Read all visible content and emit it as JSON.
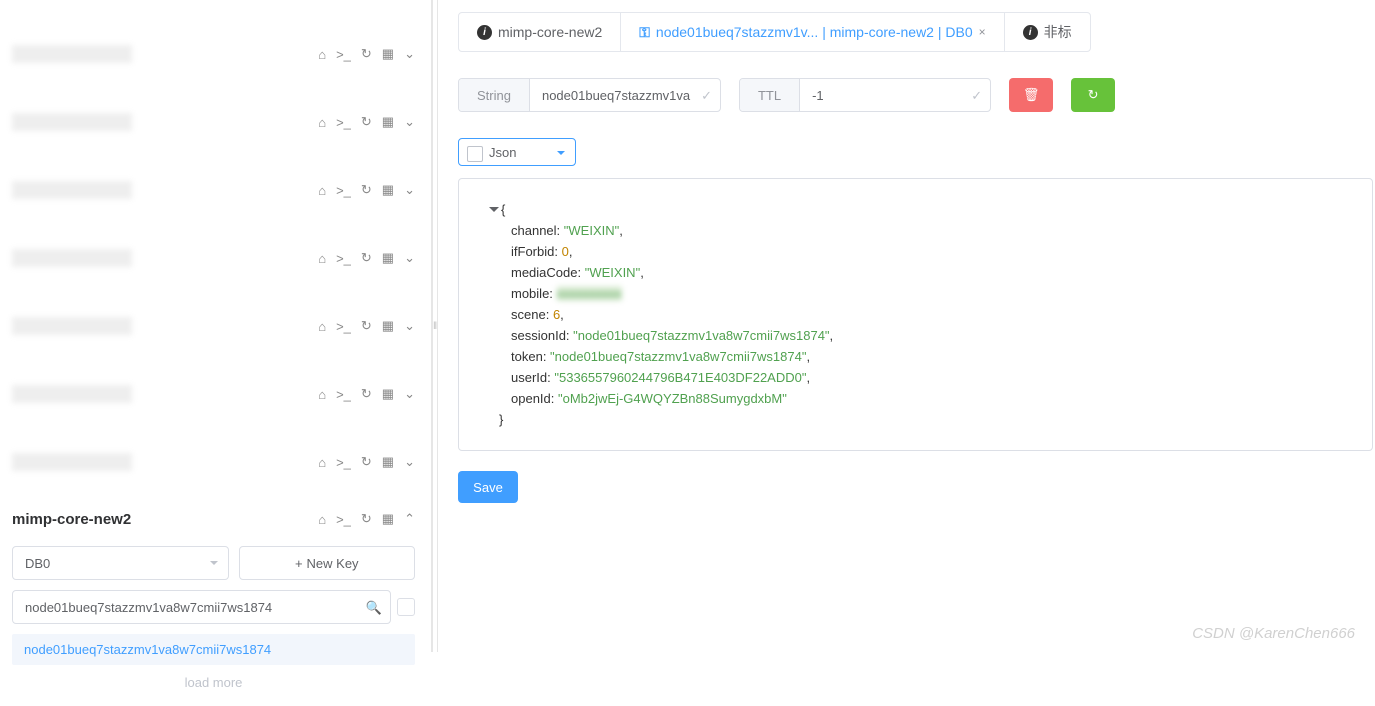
{
  "sidebar": {
    "connections": [
      0,
      1,
      2,
      3,
      4,
      5,
      6
    ],
    "openConn": {
      "title": "mimp-core-new2",
      "db": "DB0",
      "newKey": "New Key",
      "searchVal": "node01bueq7stazzmv1va8w7cmii7ws1874",
      "keyItem": "node01bueq7stazzmv1va8w7cmii7ws1874",
      "loadMore": "load more"
    }
  },
  "tabs": {
    "t1": "mimp-core-new2",
    "t2": "node01bueq7stazzmv1v... | mimp-core-new2 | DB0",
    "t3": "非标"
  },
  "fields": {
    "typeLabel": "String",
    "typeVal": "node01bueq7stazzmv1va",
    "ttlLabel": "TTL",
    "ttlVal": "-1"
  },
  "format": "Json",
  "json": {
    "channel": "\"WEIXIN\"",
    "ifForbid": "0",
    "mediaCode": "\"WEIXIN\"",
    "mobile": "xxxxxxxxxx",
    "scene": "6",
    "sessionId": "\"node01bueq7stazzmv1va8w7cmii7ws1874\"",
    "token": "\"node01bueq7stazzmv1va8w7cmii7ws1874\"",
    "userId": "\"5336557960244796B471E403DF22ADD0\"",
    "openId": "\"oMb2jwEj-G4WQYZBn88SumygdxbM\""
  },
  "saveLabel": "Save",
  "watermark": "CSDN @KarenChen666"
}
